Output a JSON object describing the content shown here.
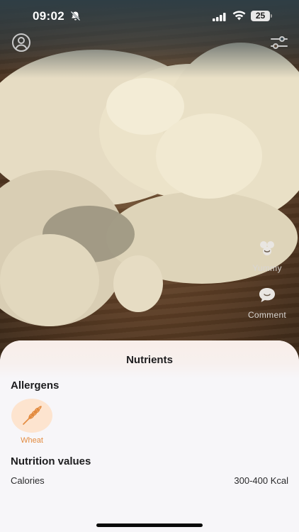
{
  "status_bar": {
    "time": "09:02",
    "battery": "25"
  },
  "header": {
    "profile_icon": "person-circle-icon",
    "filter_icon": "sliders-icon"
  },
  "side_actions": {
    "yummy_label": "Yummy",
    "comment_label": "Comment"
  },
  "sheet": {
    "title": "Nutrients",
    "allergens_title": "Allergens",
    "allergens": [
      {
        "name": "Wheat",
        "icon": "wheat-icon"
      }
    ],
    "nutrition_title": "Nutrition values",
    "nutrition_values": [
      {
        "label": "Calories",
        "value": "300-400 Kcal"
      }
    ]
  },
  "colors": {
    "accent": "#e38b3f",
    "allergen_bg": "#fde4cf",
    "sheet_bg": "#f7f6f9"
  }
}
